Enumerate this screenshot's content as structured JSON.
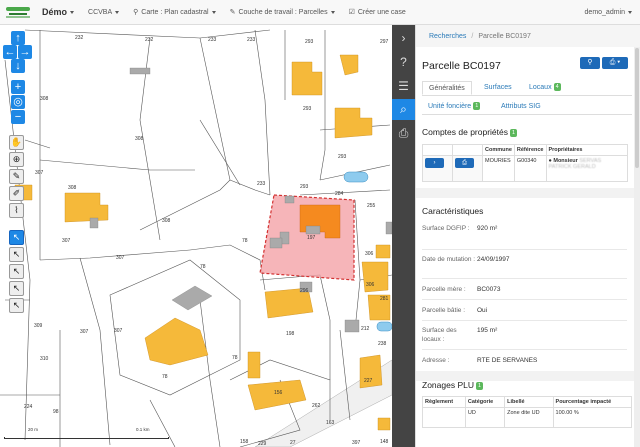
{
  "topbar": {
    "brand": "Démo",
    "items": [
      {
        "label": "CCVBA",
        "icon": ""
      },
      {
        "label": "Carte : Plan cadastral",
        "icon": "map-marker-icon"
      },
      {
        "label": "Couche de travail : Parcelles",
        "icon": "pencil-icon"
      },
      {
        "label": "Créer une case",
        "icon": "edit-square-icon"
      }
    ],
    "user": "demo_admin"
  },
  "map": {
    "parcel_numbers": [
      "232",
      "232",
      "233",
      "233",
      "308",
      "308",
      "308",
      "307",
      "307",
      "307",
      "307",
      "308",
      "306",
      "297",
      "293",
      "293",
      "293",
      "233",
      "293",
      "296",
      "197",
      "78",
      "78",
      "78",
      "78",
      "198",
      "198",
      "198",
      "198",
      "309",
      "310",
      "307",
      "224",
      "98",
      "156",
      "262",
      "227",
      "163",
      "255",
      "284",
      "212",
      "238",
      "306",
      "281",
      "156",
      "158",
      "397",
      "148",
      "229",
      "27"
    ],
    "scale": {
      "label_left": "20 m",
      "label_right": "0.1 km"
    }
  },
  "iconbar": [
    "chevron-right-icon",
    "question-icon",
    "list-icon",
    "search-icon",
    "print-icon"
  ],
  "panel": {
    "breadcrumb": [
      "Recherches",
      "Parcelle BC0197"
    ],
    "title": "Parcelle BC0197",
    "tabs": [
      {
        "label": "Généralités",
        "active": true
      },
      {
        "label": "Surfaces"
      },
      {
        "label": "Locaux",
        "badge": "4"
      },
      {
        "label": "Unité foncière",
        "badge": "1"
      },
      {
        "label": "Attributs SIG"
      }
    ],
    "comptes": {
      "heading": "Comptes de propriétés",
      "badge": "1",
      "headers": [
        "Commune",
        "Référence",
        "Propriétaires"
      ],
      "row": {
        "commune": "MOURIES",
        "reference": "G00340",
        "owner_prefix": "Monsieur",
        "owner_blurred": "SERVAS PATRICK GERALD"
      }
    },
    "caracteristiques": {
      "heading": "Caractéristiques",
      "rows": [
        {
          "key": "Surface DGFIP :",
          "value": "920 m²"
        },
        {
          "key": "Date de mutation :",
          "value": "24/09/1997"
        },
        {
          "key": "Parcelle mère :",
          "value": "BC0073"
        },
        {
          "key": "Parcelle bâtie :",
          "value": "Oui"
        },
        {
          "key": "Surface des locaux :",
          "value": "195 m²"
        },
        {
          "key": "Adresse :",
          "value": "RTE DE SERVANES"
        }
      ]
    },
    "zonages": {
      "heading": "Zonages PLU",
      "badge": "1",
      "headers": [
        "Règlement",
        "Catégorie",
        "Libellé",
        "Pourcentage impacté"
      ],
      "row": [
        "",
        "UD",
        "Zone dite UD",
        "100.00 %"
      ]
    }
  },
  "colors": {
    "accent": "#1e88e5",
    "building": "#f5b93a",
    "selected": "#f4a3a8",
    "badge": "#5cb85c"
  }
}
